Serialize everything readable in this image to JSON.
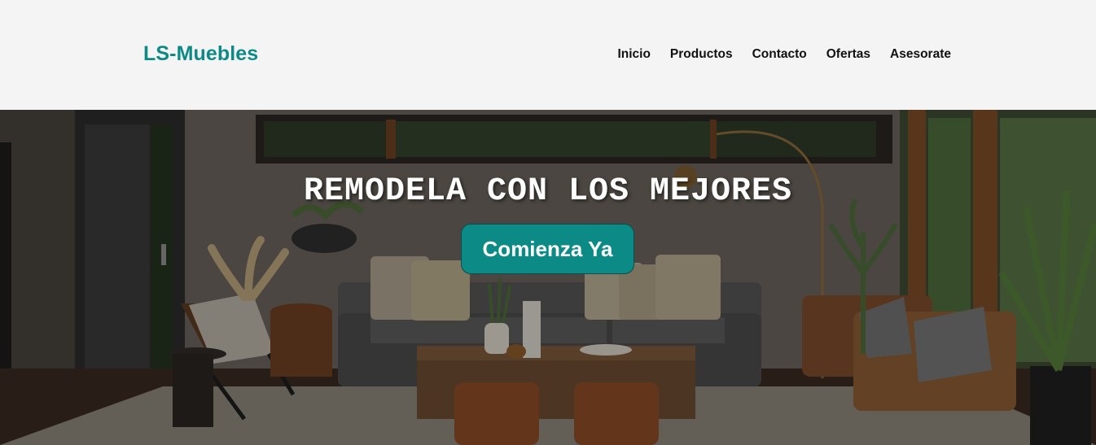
{
  "header": {
    "logo": "LS-Muebles",
    "nav": [
      {
        "label": "Inicio"
      },
      {
        "label": "Productos"
      },
      {
        "label": "Contacto"
      },
      {
        "label": "Ofertas"
      },
      {
        "label": "Asesorate"
      }
    ]
  },
  "hero": {
    "title": "REMODELA CON LOS MEJORES",
    "cta_label": "Comienza Ya",
    "background_image": "living-room-photo"
  },
  "colors": {
    "brand": "#0d8a86",
    "header_bg": "#f4f4f4",
    "nav_text": "#111111",
    "hero_text": "#ffffff"
  }
}
